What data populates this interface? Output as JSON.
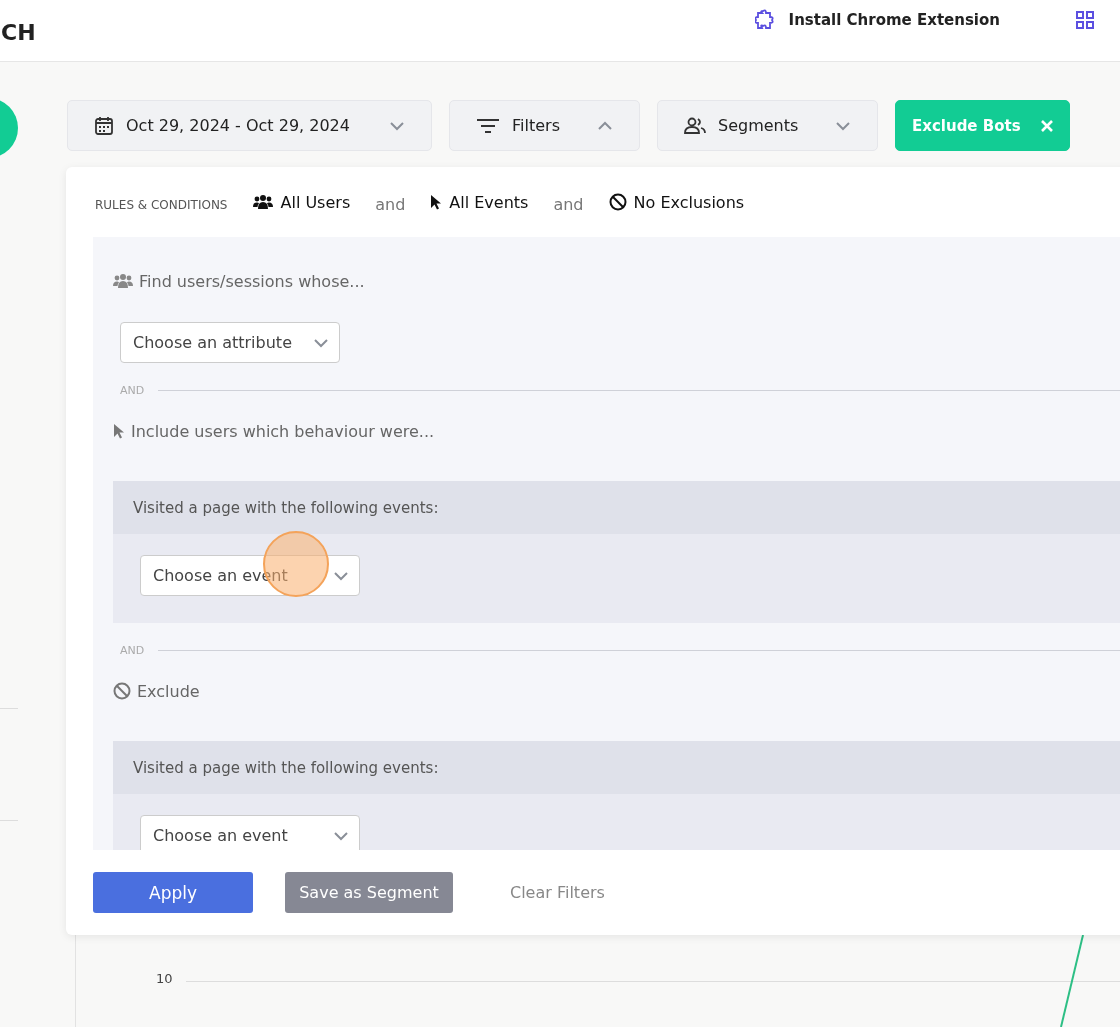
{
  "header": {
    "logo_text": "CH",
    "extension_link": "Install Chrome Extension"
  },
  "filter_bar": {
    "date_range": {
      "label": "Oct 29, 2024 - Oct 29, 2024",
      "expanded": false
    },
    "filters": {
      "label": "Filters",
      "expanded": true
    },
    "segments": {
      "label": "Segments",
      "expanded": false
    },
    "exclude_bots": {
      "label": "Exclude Bots"
    }
  },
  "rules_panel": {
    "heading": "RULES & CONDITIONS",
    "summary": [
      {
        "kind": "users",
        "label": "All Users"
      },
      {
        "kind": "joiner",
        "label": "and"
      },
      {
        "kind": "events",
        "label": "All Events"
      },
      {
        "kind": "joiner",
        "label": "and"
      },
      {
        "kind": "exclusions",
        "label": "No Exclusions"
      }
    ],
    "sections": [
      {
        "kind": "attribute",
        "title": "Find users/sessions whose...",
        "dropdown": "Choose an attribute"
      },
      {
        "kind": "divider",
        "label": "AND"
      },
      {
        "kind": "behaviour",
        "title": "Include users which behaviour were...",
        "block_title": "Visited a page with the following events:",
        "dropdown": "Choose an event"
      },
      {
        "kind": "divider",
        "label": "AND"
      },
      {
        "kind": "exclude",
        "title": "Exclude",
        "block_title": "Visited a page with the following events:",
        "dropdown": "Choose an event"
      }
    ],
    "actions": [
      {
        "kind": "primary",
        "label": "Apply"
      },
      {
        "kind": "secondary",
        "label": "Save as Segment"
      },
      {
        "kind": "link",
        "label": "Clear Filters"
      }
    ]
  },
  "chart": {
    "y_tick": "10"
  }
}
